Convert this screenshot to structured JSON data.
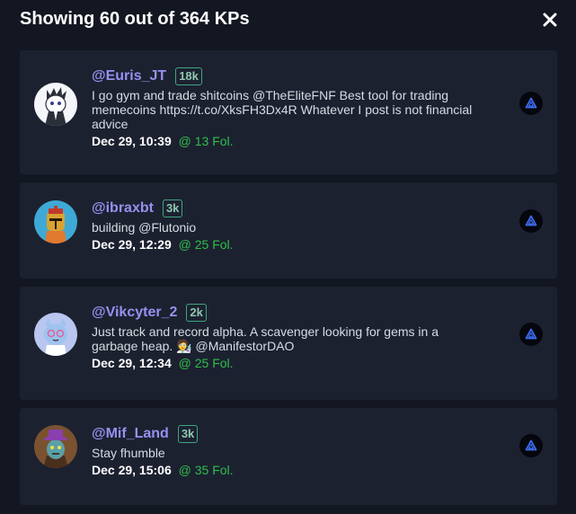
{
  "header": {
    "title": "Showing 60 out of 364 KPs"
  },
  "kps": [
    {
      "handle": "@Euris_JT",
      "badge": "18k",
      "bio": "I go gym and trade shitcoins @TheEliteFNF Best tool for trading memecoins https://t.co/XksFH3Dx4R Whatever I post is not financial advice",
      "time": "Dec 29, 10:39",
      "followers": "@ 13 Fol."
    },
    {
      "handle": "@ibraxbt",
      "badge": "3k",
      "bio": "building @Flutonio",
      "time": "Dec 29, 12:29",
      "followers": "@ 25 Fol."
    },
    {
      "handle": "@Vikcyter_2",
      "badge": "2k",
      "bio": "Just track and record alpha. A scavenger looking for gems in a garbage heap. 🧑‍🔬 @ManifestorDAO",
      "time": "Dec 29, 12:34",
      "followers": "@ 25 Fol."
    },
    {
      "handle": "@Mif_Land",
      "badge": "3k",
      "bio": "Stay fhumble",
      "time": "Dec 29, 15:06",
      "followers": "@ 35 Fol."
    }
  ],
  "colors": {
    "background": "#131722",
    "card": "#1c2130",
    "handle": "#9a8ff0",
    "badge_border": "#3fa77d",
    "followers": "#2fbf4a"
  },
  "icons": {
    "close": "close-icon",
    "platform": "platform-logo-icon"
  }
}
